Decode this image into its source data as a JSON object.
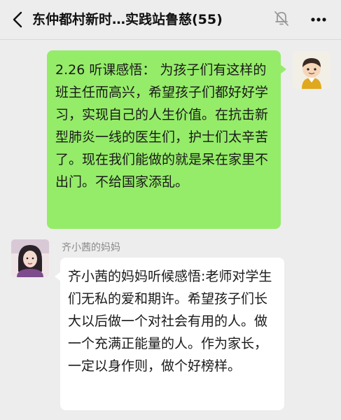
{
  "header": {
    "title": "东仲都村新时…实践站鲁慈(55)",
    "back_icon": "chevron-left-icon",
    "mute_icon": "bell-muted-icon",
    "more_icon": "more-dots-icon"
  },
  "messages": [
    {
      "sender": "self",
      "avatar_icon": "cartoon-avatar",
      "text": "2.26 听课感悟： 为孩子们有这样的班主任而高兴，希望孩子们都好好学习，实现自己的人生价值。在抗击新型肺炎一线的医生们，护士们太辛苦了。现在我们能做的就是呆在家里不出门。不给国家添乱。"
    },
    {
      "sender": "other",
      "sender_name": "齐小茜的妈妈",
      "avatar_icon": "photo-avatar",
      "text": "齐小茜的妈妈听候感悟:老师对学生们无私的爱和期许。希望孩子们长大以后做一个对社会有用的人。做一个充满正能量的人。作为家长，一定以身作则，做个好榜样。"
    }
  ],
  "colors": {
    "background": "#ededed",
    "self_bubble": "#95ec69",
    "other_bubble": "#ffffff"
  }
}
